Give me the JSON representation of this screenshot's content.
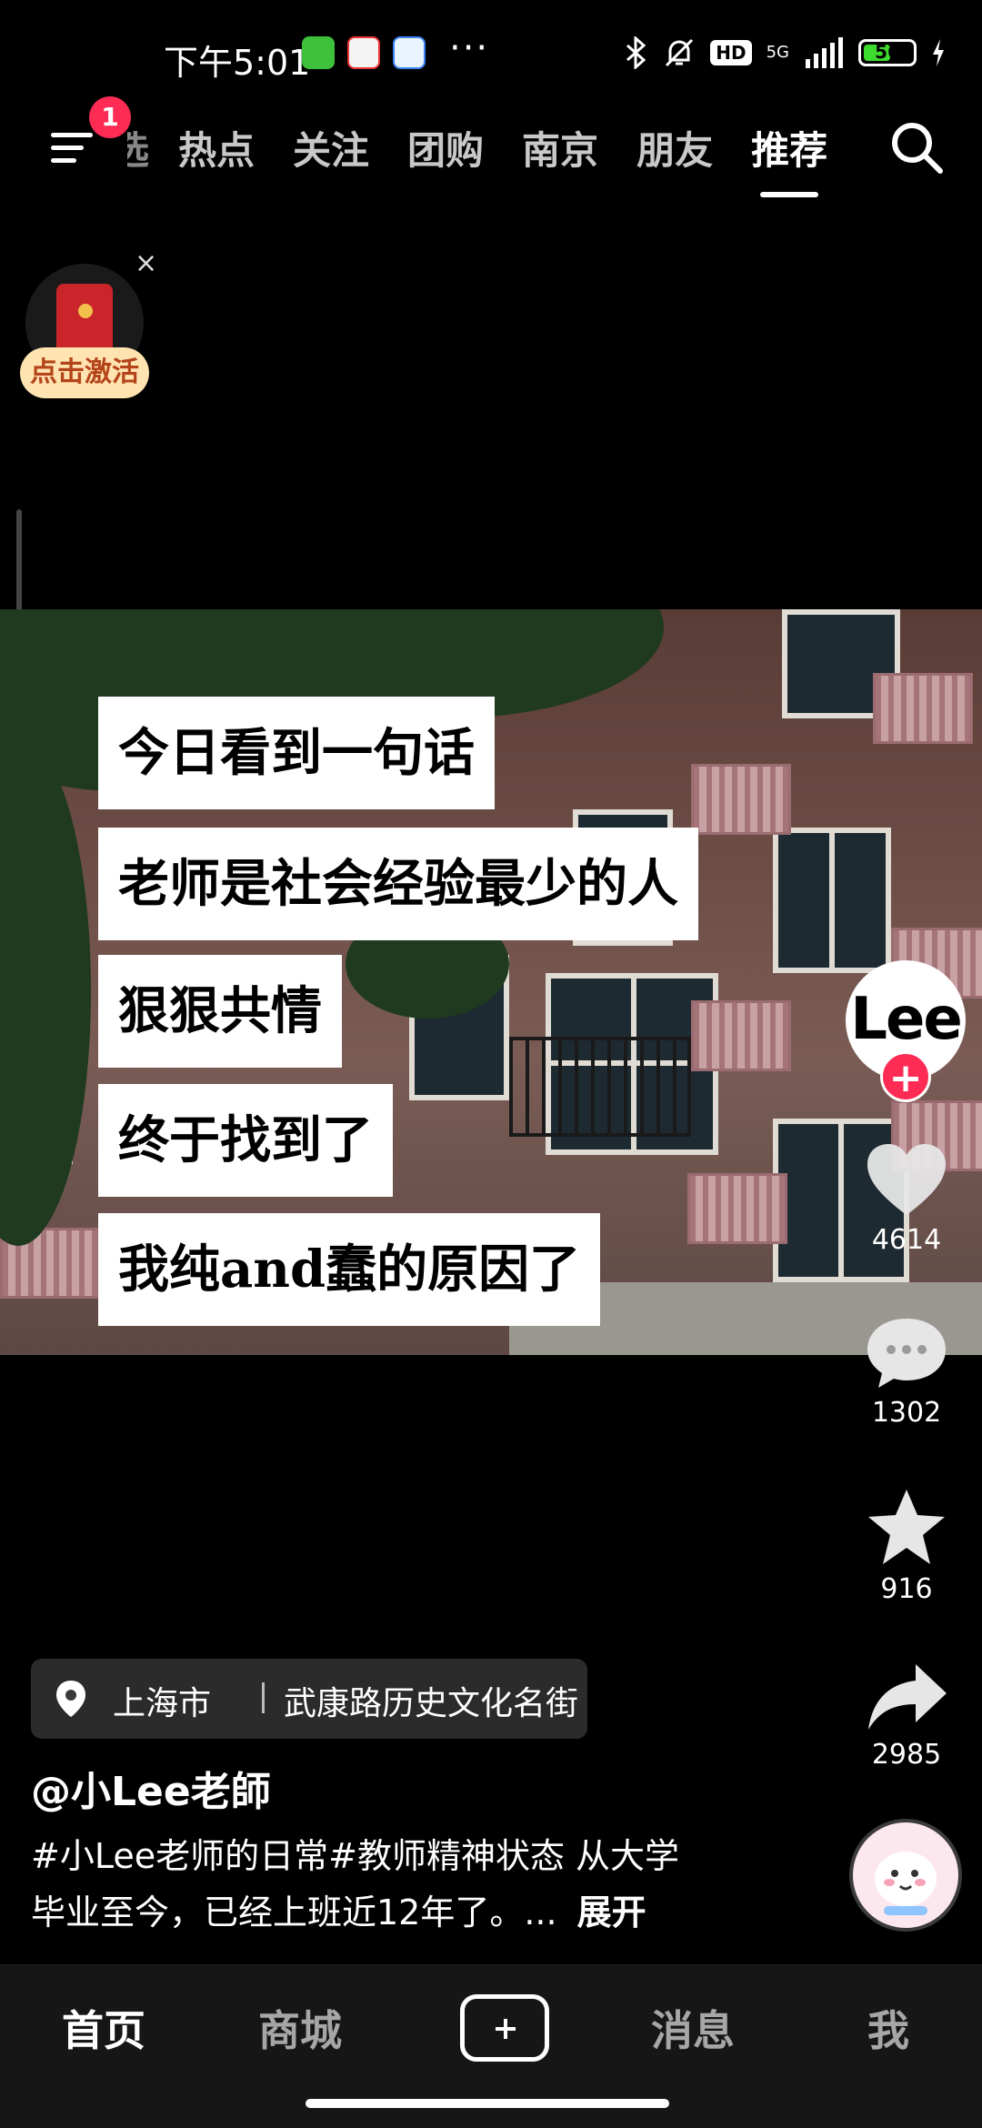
{
  "status_bar": {
    "time": "下午5:01",
    "more": "···",
    "hd": "HD",
    "network": "5G",
    "battery_level": 56,
    "battery_text": "56"
  },
  "top_nav": {
    "notification_count": "1",
    "partial_tab": "精选",
    "tabs": [
      "热点",
      "关注",
      "团购",
      "南京",
      "朋友",
      "推荐"
    ],
    "active_tab": "推荐"
  },
  "red_packet": {
    "label": "点击激活",
    "close": "×"
  },
  "video": {
    "captions": [
      "今日看到一句话",
      "老师是社会经验最少的人",
      "狠狠共情",
      "终于找到了",
      "我纯and蠢的原因了"
    ]
  },
  "right_rail": {
    "avatar_text": "Lee",
    "follow_plus": "+",
    "likes": "4614",
    "comments": "1302",
    "favorites": "916",
    "shares": "2985"
  },
  "post": {
    "location_city": "上海市",
    "location_place": "武康路历史文化名街",
    "author": "@小Lee老師",
    "description_line1": "#小Lee老师的日常#教师精神状态 从大学",
    "description_line2": "毕业至今，已经上班近12年了。...",
    "expand": "展开"
  },
  "tab_bar": {
    "home": "首页",
    "mall": "商城",
    "messages": "消息",
    "me": "我"
  },
  "colors": {
    "accent_red": "#fe2c55",
    "background": "#000000",
    "tabbar_bg": "#161616"
  }
}
